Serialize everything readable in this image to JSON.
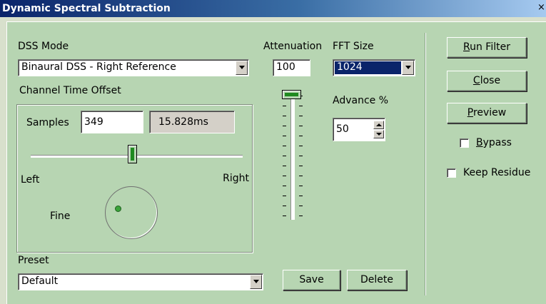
{
  "window": {
    "title": "Dynamic Spectral Subtraction",
    "close_glyph": "×"
  },
  "dss_mode": {
    "label": "DSS Mode",
    "selected": "Binaural DSS - Right Reference"
  },
  "channel_time_offset": {
    "label": "Channel Time Offset",
    "samples_label": "Samples",
    "samples_value": "349",
    "ms_value": "15.828ms",
    "slider": {
      "left_label": "Left",
      "right_label": "Right",
      "position": 0.5
    },
    "fine_label": "Fine"
  },
  "attenuation": {
    "label": "Attenuation",
    "value": "100",
    "slider_position": 0.0
  },
  "fft": {
    "label": "FFT Size",
    "selected": "1024"
  },
  "advance": {
    "label": "Advance %",
    "value": "50"
  },
  "preset": {
    "label": "Preset",
    "selected": "Default"
  },
  "buttons": {
    "save": "Save",
    "delete": "Delete",
    "run_filter_u": "R",
    "run_filter_rest": "un Filter",
    "close_u": "C",
    "close_rest": "lose",
    "preview_u": "P",
    "preview_rest": "review"
  },
  "checkboxes": {
    "bypass_u": "B",
    "bypass_rest": "ypass",
    "bypass_checked": false,
    "keep_residue": "Keep Residue",
    "keep_residue_checked": false
  },
  "colors": {
    "dialog_bg": "#b7d5b2",
    "title_start": "#0a246a",
    "title_end": "#a6caf0",
    "selection": "#0a246a"
  }
}
